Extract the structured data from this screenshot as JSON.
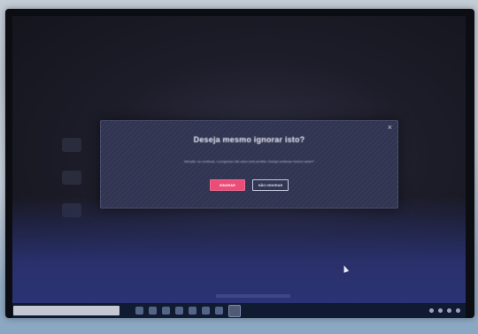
{
  "dialog": {
    "title": "Deseja mesmo ignorar isto?",
    "body": "Atenção: se continuar, o progresso não salvo será perdido. Deseja continuar mesmo assim?",
    "close_glyph": "×",
    "primary_label": "IGNORAR",
    "secondary_label": "NÃO IGNORAR"
  },
  "icons": {
    "close": "close-icon",
    "cursor": "mouse-pointer-icon"
  },
  "colors": {
    "primary_button": "#ea4e78",
    "dialog_background": "#363957",
    "taskbar": "#101a30"
  }
}
